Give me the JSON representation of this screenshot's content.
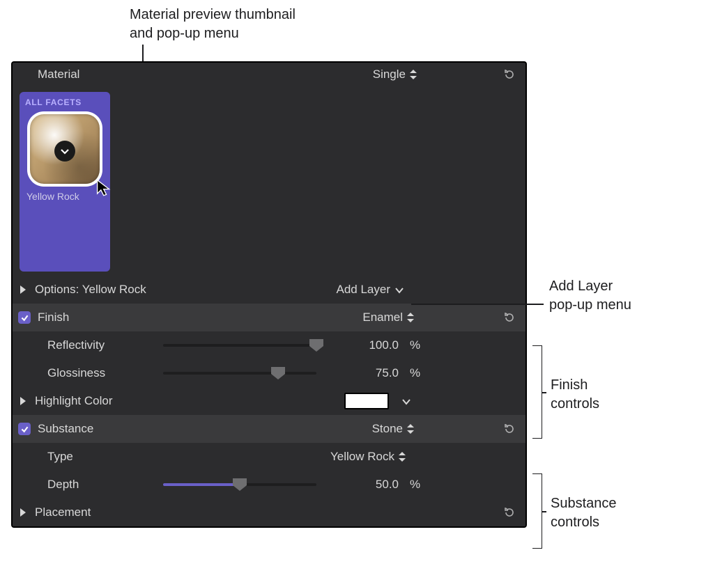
{
  "callouts": {
    "thumbnail_l1": "Material preview thumbnail",
    "thumbnail_l2": "and pop-up menu",
    "add_layer_l1": "Add Layer",
    "add_layer_l2": "pop-up menu",
    "finish_l1": "Finish",
    "finish_l2": "controls",
    "substance_l1": "Substance",
    "substance_l2": "controls"
  },
  "header": {
    "title": "Material",
    "mode": "Single"
  },
  "preset": {
    "facets": "ALL FACETS",
    "name": "Yellow Rock"
  },
  "options_label": "Options: Yellow Rock",
  "add_layer": "Add Layer",
  "finish": {
    "label": "Finish",
    "type": "Enamel",
    "reflectivity": {
      "label": "Reflectivity",
      "value": "100.0",
      "unit": "%",
      "pct": 100
    },
    "glossiness": {
      "label": "Glossiness",
      "value": "75.0",
      "unit": "%",
      "pct": 75
    },
    "highlight_label": "Highlight Color",
    "highlight_color": "#ffffff"
  },
  "substance": {
    "label": "Substance",
    "mode": "Stone",
    "type": {
      "label": "Type",
      "value": "Yellow Rock"
    },
    "depth": {
      "label": "Depth",
      "value": "50.0",
      "unit": "%",
      "pct": 50
    }
  },
  "placement_label": "Placement"
}
